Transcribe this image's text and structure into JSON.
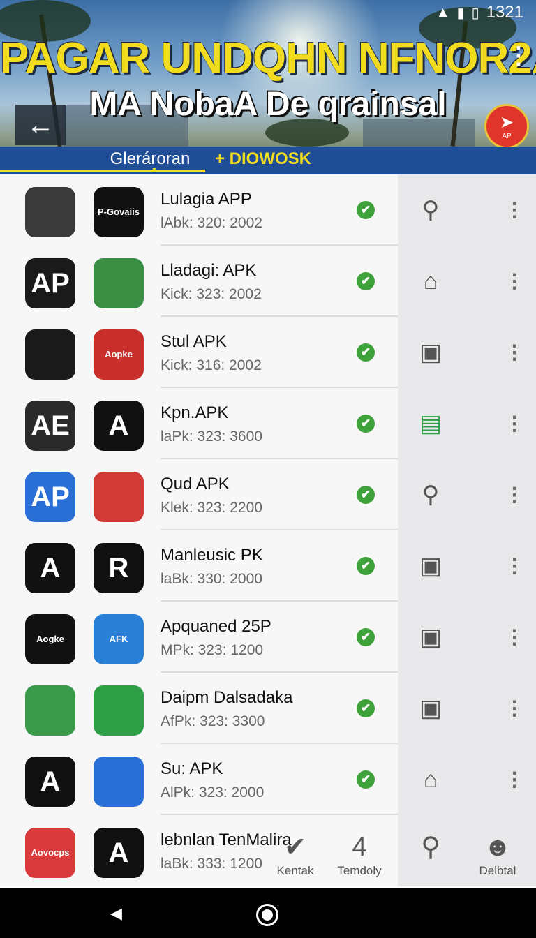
{
  "status": {
    "time": "1321",
    "wifi_icon": "wifi-icon",
    "signal_icon": "signal-icon",
    "battery_icon": "battery-icon"
  },
  "header": {
    "title": "PAGAR UNDQHN NFNOR2A",
    "subtitle": "MA NobaA De qrainsal",
    "back_icon": "arrow-left-icon",
    "more_icon": "more-vertical-icon",
    "badge_text": "AP"
  },
  "tabs": [
    {
      "label": "Glerároran",
      "active": true
    },
    {
      "label": "+ DIOWOSK",
      "active": false
    }
  ],
  "colors": {
    "tabbar": "#1f4e96",
    "accent_yellow": "#f2dc1e",
    "check_green": "#3fa13a"
  },
  "apps": [
    {
      "title": "Lulagia APP",
      "subtitle": "lAbk: 320: 2002",
      "icon1": {
        "text": "",
        "bg": "#3a3a3a"
      },
      "icon2": {
        "text": "P-Govaiis",
        "bg": "#111111"
      },
      "action_icon": "search-icon"
    },
    {
      "title": "Lladagi: APK",
      "subtitle": "Kick: 323: 2002",
      "icon1": {
        "text": "AP",
        "bg": "#1a1a1a"
      },
      "icon2": {
        "text": "",
        "bg": "#3b8f45"
      },
      "action_icon": "bag-icon"
    },
    {
      "title": "Stul APK",
      "subtitle": "Kick: 316: 2002",
      "icon1": {
        "text": "",
        "bg": "#1a1a1a"
      },
      "icon2": {
        "text": "Aopke",
        "bg": "#c9302c"
      },
      "action_icon": "camera-tag-icon"
    },
    {
      "title": "Kpn.APK",
      "subtitle": "laPk: 323: 3600",
      "icon1": {
        "text": "AE",
        "bg": "#2a2a2a"
      },
      "icon2": {
        "text": "A",
        "bg": "#111111"
      },
      "action_icon": "shopping-bag-icon"
    },
    {
      "title": "Qud APK",
      "subtitle": "Klek: 323: 2200",
      "icon1": {
        "text": "AP",
        "bg": "#2a6fd6"
      },
      "icon2": {
        "text": "",
        "bg": "#d13a35"
      },
      "action_icon": "search-icon"
    },
    {
      "title": "Manleusic PK",
      "subtitle": "laBk: 330: 2000",
      "icon1": {
        "text": "A",
        "bg": "#111111"
      },
      "icon2": {
        "text": "R",
        "bg": "#111111"
      },
      "action_icon": "camera-tag-icon"
    },
    {
      "title": "Apquaned 25P",
      "subtitle": "MPk: 323: 1200",
      "icon1": {
        "text": "Aogke",
        "bg": "#111111"
      },
      "icon2": {
        "text": "AFK",
        "bg": "#2a7fd6"
      },
      "action_icon": "camera-tag-icon"
    },
    {
      "title": "Daipm Dalsadaka",
      "subtitle": "AfPk: 323: 3300",
      "icon1": {
        "text": "",
        "bg": "#3b9a4a"
      },
      "icon2": {
        "text": "",
        "bg": "#2e9e47"
      },
      "action_icon": "camera-tag-icon"
    },
    {
      "title": "Su: APK",
      "subtitle": "AlPk: 323: 2000",
      "icon1": {
        "text": "A",
        "bg": "#111111"
      },
      "icon2": {
        "text": "",
        "bg": "#2a6fd6"
      },
      "action_icon": "bag-icon"
    },
    {
      "title": "lebnlan TenMalira",
      "subtitle": "laBk: 333: 1200",
      "icon1": {
        "text": "Aovocps",
        "bg": "#d8393a"
      },
      "icon2": {
        "text": "A",
        "bg": "#111111"
      },
      "action_icon": "search-icon"
    }
  ],
  "bottom_tabs": [
    {
      "label": "Kentak",
      "icon": "check-circle-icon"
    },
    {
      "label": "Temdoly",
      "icon": "battery-tab-icon",
      "glyph_text": "4"
    },
    {
      "label": "",
      "icon": "search-icon"
    },
    {
      "label": "Delbtal",
      "icon": "account-icon"
    }
  ],
  "navbar": {
    "back_icon": "nav-back-icon",
    "home_icon": "nav-home-icon"
  }
}
